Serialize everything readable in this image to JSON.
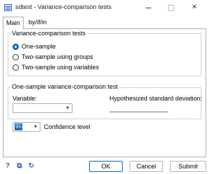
{
  "window": {
    "title": "sdtest - Variance-comparison tests",
    "minimize_glyph": "",
    "maximize_glyph": "",
    "close_glyph": "✕"
  },
  "tabs": [
    {
      "label": "Main",
      "active": true
    },
    {
      "label": "by/if/in",
      "active": false
    }
  ],
  "variance_group": {
    "title": "Variance-comparison tests",
    "options": [
      {
        "label": "One-sample",
        "checked": true
      },
      {
        "label": "Two-sample using groups",
        "checked": false
      },
      {
        "label": "Two-sample using variables",
        "checked": false
      }
    ]
  },
  "one_sample_group": {
    "title": "One-sample variance-comparison test",
    "variable_label": "Variable:",
    "variable_value": "",
    "hypothesized_label": "Hypothesized standard deviation:",
    "hypothesized_value": ""
  },
  "confidence": {
    "value": "95",
    "label": "Confidence level"
  },
  "bottom": {
    "help_glyph": "?",
    "copy_glyph": "⧉",
    "reset_glyph": "↻",
    "ok_label": "OK",
    "cancel_label": "Cancel",
    "submit_label": "Submit"
  },
  "icons": {
    "app": "stata-dialog-icon",
    "help": "help-icon",
    "copy": "copy-command-icon",
    "reset": "reset-icon",
    "chevron": "chevron-down-icon"
  },
  "colors": {
    "accent": "#0067c0",
    "border": "#adadad"
  }
}
